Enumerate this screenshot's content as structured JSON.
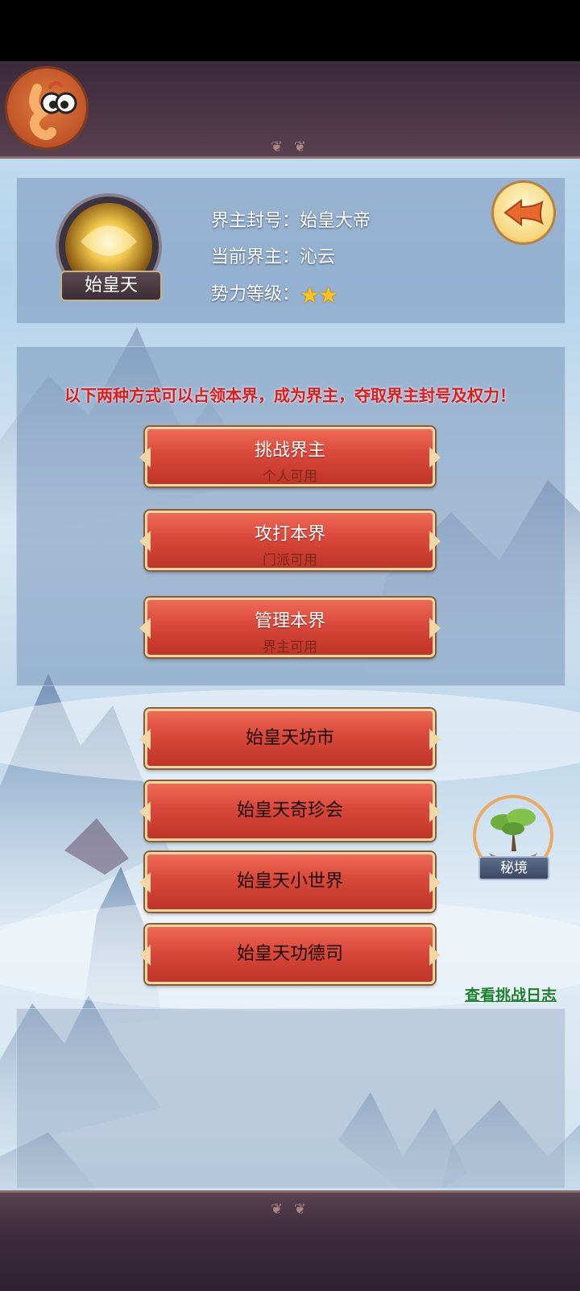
{
  "realm": {
    "name": "始皇天",
    "title_label": "界主封号：",
    "title_value": "始皇大帝",
    "lord_label": "当前界主：",
    "lord_value": "沁云",
    "level_label": "势力等级：",
    "level_stars": 2
  },
  "notice": "以下两种方式可以占领本界，成为界主，夺取界主封号及权力！",
  "actions": [
    {
      "label": "挑战界主",
      "sub": "个人可用"
    },
    {
      "label": "攻打本界",
      "sub": "门派可用"
    },
    {
      "label": "管理本界",
      "sub": "界主可用"
    }
  ],
  "features": [
    {
      "label": "始皇天坊市"
    },
    {
      "label": "始皇天奇珍会"
    },
    {
      "label": "始皇天小世界"
    },
    {
      "label": "始皇天功德司"
    }
  ],
  "secret_realm": {
    "label": "秘境"
  },
  "log_link": "查看挑战日志",
  "icons": {
    "avatar": "worm-mascot-icon",
    "back": "back-arrow-icon",
    "realm_emblem": "golden-orb-emblem-icon",
    "secret_realm": "floating-island-tree-icon",
    "star": "star-icon"
  },
  "colors": {
    "notice_red": "#e01b1b",
    "button_red": "#d9483b",
    "link_green": "#1a7f2f",
    "star_gold": "#ffc21a"
  }
}
